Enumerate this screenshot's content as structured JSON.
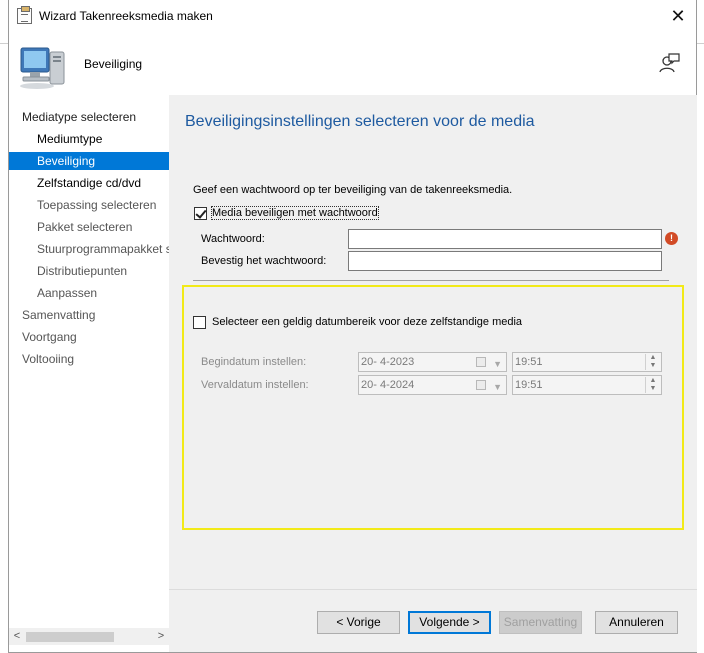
{
  "window": {
    "title": "Wizard Takenreeksmedia maken",
    "close_glyph": "✕"
  },
  "header": {
    "page_title": "Beveiliging",
    "icon": "computer-icon",
    "help_icon": "person-help-icon"
  },
  "nav": {
    "items": [
      {
        "label": "Mediatype selecteren",
        "level": "top",
        "state": "normal"
      },
      {
        "label": "Mediumtype",
        "level": "sub",
        "state": "done"
      },
      {
        "label": "Beveiliging",
        "level": "sub",
        "state": "selected"
      },
      {
        "label": "Zelfstandige cd/dvd",
        "level": "sub",
        "state": "done"
      },
      {
        "label": "Toepassing selecteren",
        "level": "sub",
        "state": "pending"
      },
      {
        "label": "Pakket selecteren",
        "level": "sub",
        "state": "pending"
      },
      {
        "label": "Stuurprogrammapakket s",
        "level": "sub",
        "state": "pending"
      },
      {
        "label": "Distributiepunten",
        "level": "sub",
        "state": "pending"
      },
      {
        "label": "Aanpassen",
        "level": "sub",
        "state": "pending"
      },
      {
        "label": "Samenvatting",
        "level": "top",
        "state": "pending"
      },
      {
        "label": "Voortgang",
        "level": "top",
        "state": "pending"
      },
      {
        "label": "Voltooiing",
        "level": "top",
        "state": "pending"
      }
    ]
  },
  "content": {
    "title": "Beveiligingsinstellingen selecteren voor de media",
    "intro": "Geef een wachtwoord op ter beveiliging van de takenreeksmedia.",
    "protect_checkbox": {
      "label": "Media beveiligen met wachtwoord",
      "checked": true
    },
    "password_label": "Wachtwoord:",
    "password_value": "",
    "confirm_label": "Bevestig het wachtwoord:",
    "confirm_value": "",
    "warning_glyph": "!",
    "date_range_checkbox": {
      "label": "Selecteer een geldig datumbereik voor deze zelfstandige media",
      "checked": false
    },
    "start_label": "Begindatum instellen:",
    "start_date": "20-  4-2023",
    "start_time": "19:51",
    "end_label": "Vervaldatum instellen:",
    "end_date": "20-  4-2024",
    "end_time": "19:51"
  },
  "footer": {
    "prev": "< Vorige",
    "next": "Volgende >",
    "summary": "Samenvatting",
    "cancel": "Annuleren"
  },
  "colors": {
    "accent": "#0078d7",
    "highlight_border": "#f2ea18",
    "title_blue": "#1e5aa0",
    "warning": "#d24b26"
  }
}
